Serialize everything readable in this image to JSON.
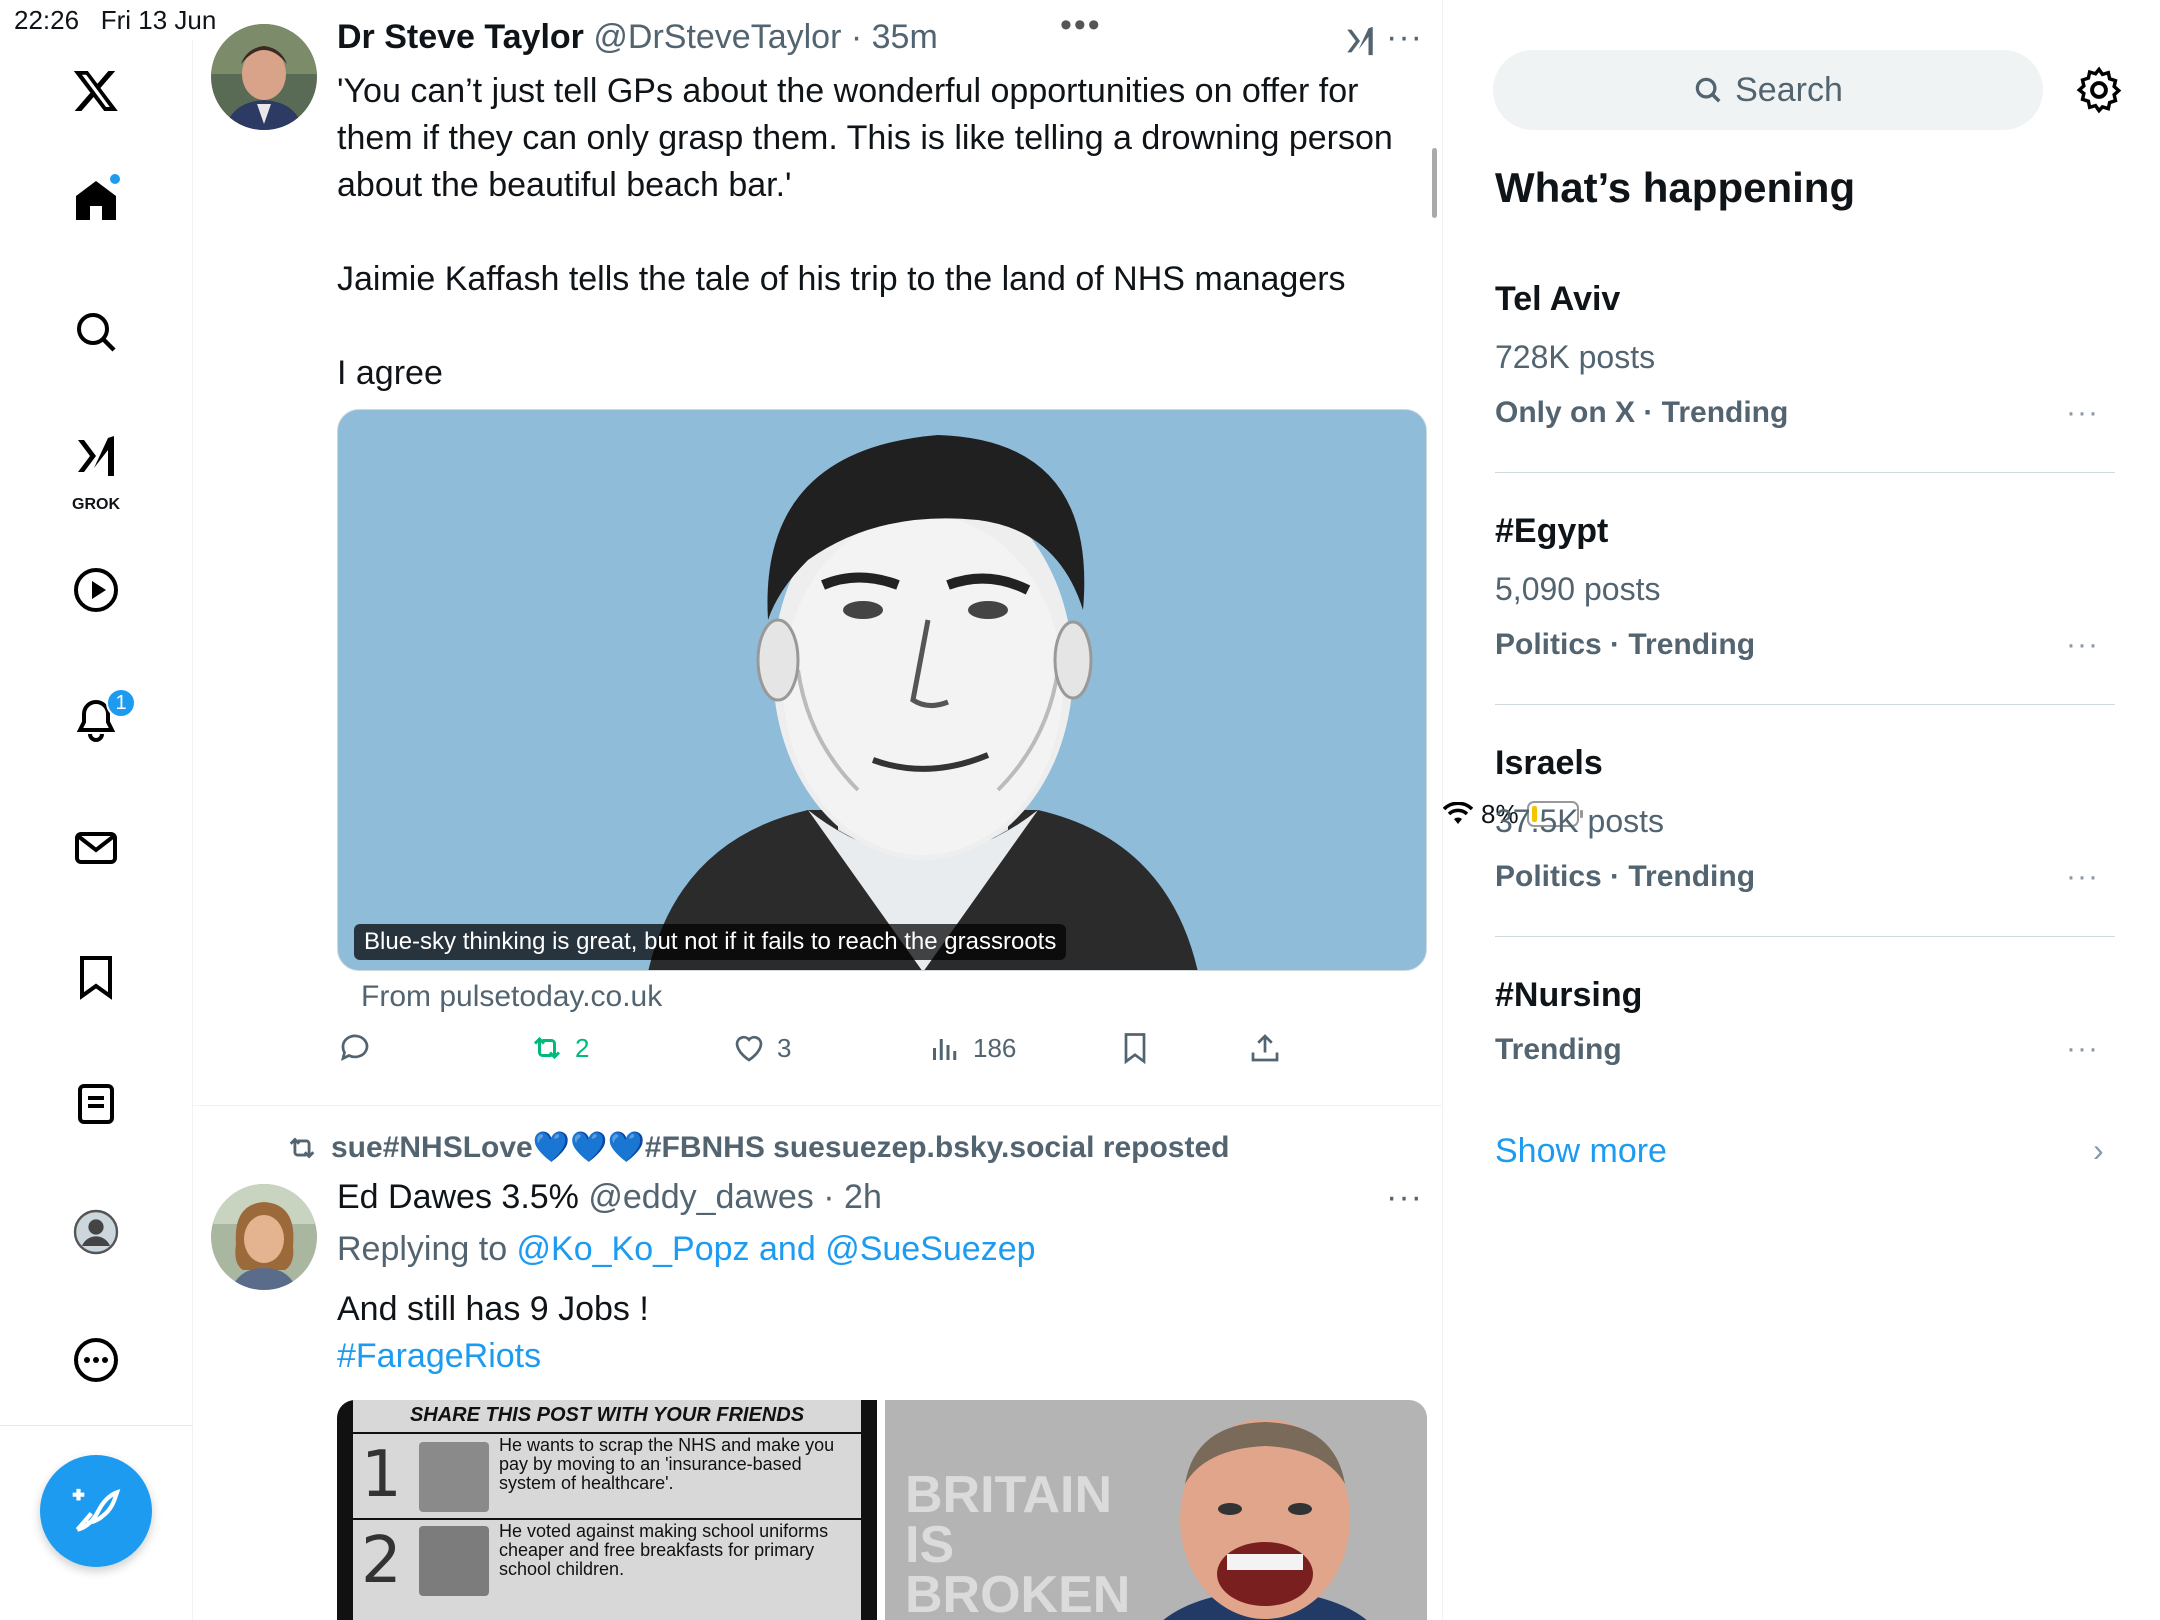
{
  "status_bar": {
    "time": "22:26",
    "date": "Fri 13 Jun",
    "battery": "8%",
    "battery_level": 0.08
  },
  "nav": {
    "items": [
      {
        "name": "x-logo-icon"
      },
      {
        "name": "home-icon",
        "has_dot": true
      },
      {
        "name": "search-icon"
      },
      {
        "name": "grok-icon",
        "label": "GROK"
      },
      {
        "name": "video-icon"
      },
      {
        "name": "notifications-icon",
        "badge": "1"
      },
      {
        "name": "messages-icon"
      },
      {
        "name": "bookmarks-icon"
      },
      {
        "name": "lists-icon"
      },
      {
        "name": "profile-icon"
      },
      {
        "name": "more-icon"
      }
    ],
    "grok_label": "GROK",
    "notification_badge": "1",
    "accent_color": "#1d9bf0"
  },
  "post1": {
    "name": "Dr Steve Taylor",
    "handle": "@DrSteveTaylor",
    "sep": "·",
    "time": "35m",
    "text": "'You can’t just tell GPs about the wonderful opportunities on offer for them if they can only grasp them. This is like telling a drowning person about the beautiful beach bar.'\n\nJaimie Kaffash tells the tale of his trip to the land of NHS managers\n\nI agree",
    "media_caption": "Blue-sky thinking is great, but not if it fails to reach the grassroots",
    "source": "From pulsetoday.co.uk",
    "reposts": "2",
    "likes": "3",
    "views": "186"
  },
  "post2": {
    "repost_by_prefix": "sue#NHSLove",
    "repost_by_hearts": "💙💙💙",
    "repost_by_suffix": "#FBNHS suesuezep.bsky.social reposted",
    "name": "Ed Dawes 3.5%",
    "handle": "@eddy_dawes",
    "sep": "·",
    "time": "2h",
    "replying_prefix": "Replying to ",
    "reply_to_1": "@Ko_Ko_Popz",
    "reply_and": " and ",
    "reply_to_2": "@SueSuezep",
    "text": "And still has 9 Jobs !",
    "hashtag": "#FarageRiots",
    "image1_heading": "SHARE THIS POST WITH YOUR FRIENDS",
    "image1_item1": "He wants to scrap the NHS and make you pay by moving to an 'insurance-based system of healthcare'.",
    "image1_item2": "He voted against making school uniforms cheaper and free breakfasts for primary school children.",
    "image2_text": "BRITAIN IS BROKEN"
  },
  "right": {
    "search_placeholder": "Search",
    "section_title": "What’s happening",
    "trends": [
      {
        "title": "Tel Aviv",
        "count": "728K posts",
        "meta": "Only on X · Trending"
      },
      {
        "title": "#Egypt",
        "count": "5,090 posts",
        "meta": "Politics · Trending"
      },
      {
        "title": "Israels",
        "count": "37.5K posts",
        "meta": "Politics · Trending"
      },
      {
        "title": "#Nursing",
        "count": "",
        "meta": "Trending"
      }
    ],
    "show_more": "Show more"
  }
}
